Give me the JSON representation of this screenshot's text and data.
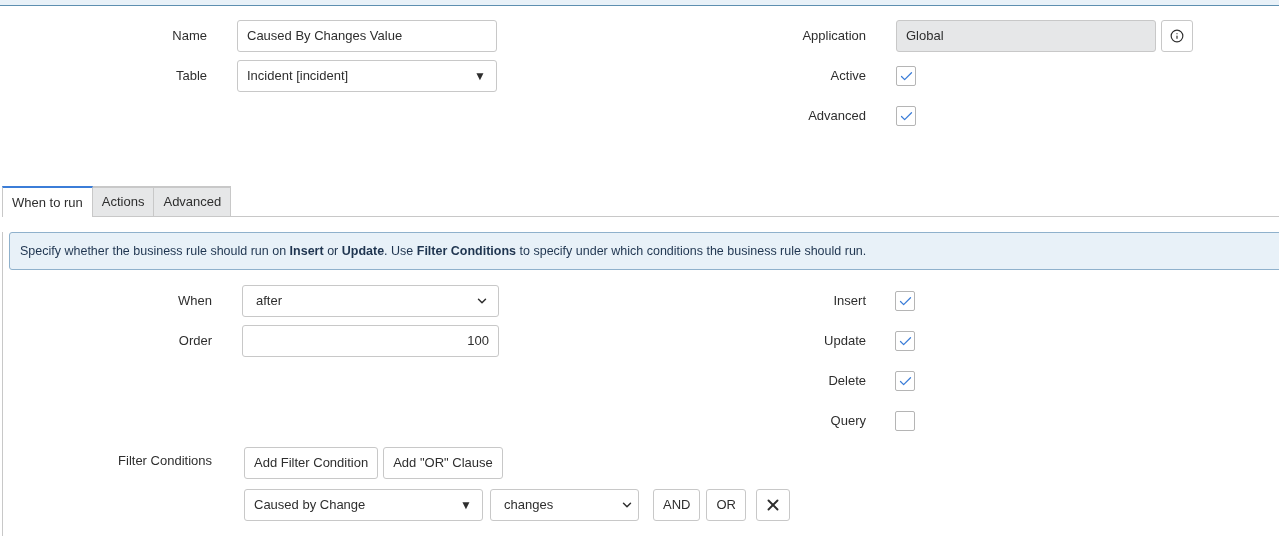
{
  "header": {
    "fields_left": [
      {
        "label": "Name",
        "kind": "text",
        "value": "Caused By Changes Value"
      },
      {
        "label": "Table",
        "kind": "reference",
        "value": "Incident [incident]",
        "arrow": "▼"
      }
    ],
    "fields_right": [
      {
        "label": "Application",
        "kind": "readonly",
        "value": "Global"
      },
      {
        "label": "Active",
        "kind": "checkbox",
        "checked": true
      },
      {
        "label": "Advanced",
        "kind": "checkbox",
        "checked": true
      }
    ]
  },
  "tabs": [
    {
      "label": "When to run",
      "selected": true
    },
    {
      "label": "Actions",
      "selected": false
    },
    {
      "label": "Advanced",
      "selected": false
    }
  ],
  "info": "Specify whether the business rule should run on **Insert** or **Update**. Use **Filter Conditions** to specify under which conditions the business rule should run.",
  "when_to_run": {
    "fields": [
      {
        "label": "When",
        "kind": "select",
        "value": "after"
      },
      {
        "label": "Order",
        "kind": "number",
        "value": "100"
      }
    ],
    "checkboxes": [
      {
        "label": "Insert",
        "checked": true
      },
      {
        "label": "Update",
        "checked": true
      },
      {
        "label": "Delete",
        "checked": true
      },
      {
        "label": "Query",
        "checked": false
      }
    ],
    "filter": {
      "label": "Filter Conditions",
      "buttons": [
        "Add Filter Condition",
        "Add \"OR\" Clause"
      ],
      "condition": {
        "field": "Caused by Change",
        "arrow": "▼",
        "operator": "changes",
        "buttons": [
          "AND",
          "OR"
        ]
      }
    }
  }
}
